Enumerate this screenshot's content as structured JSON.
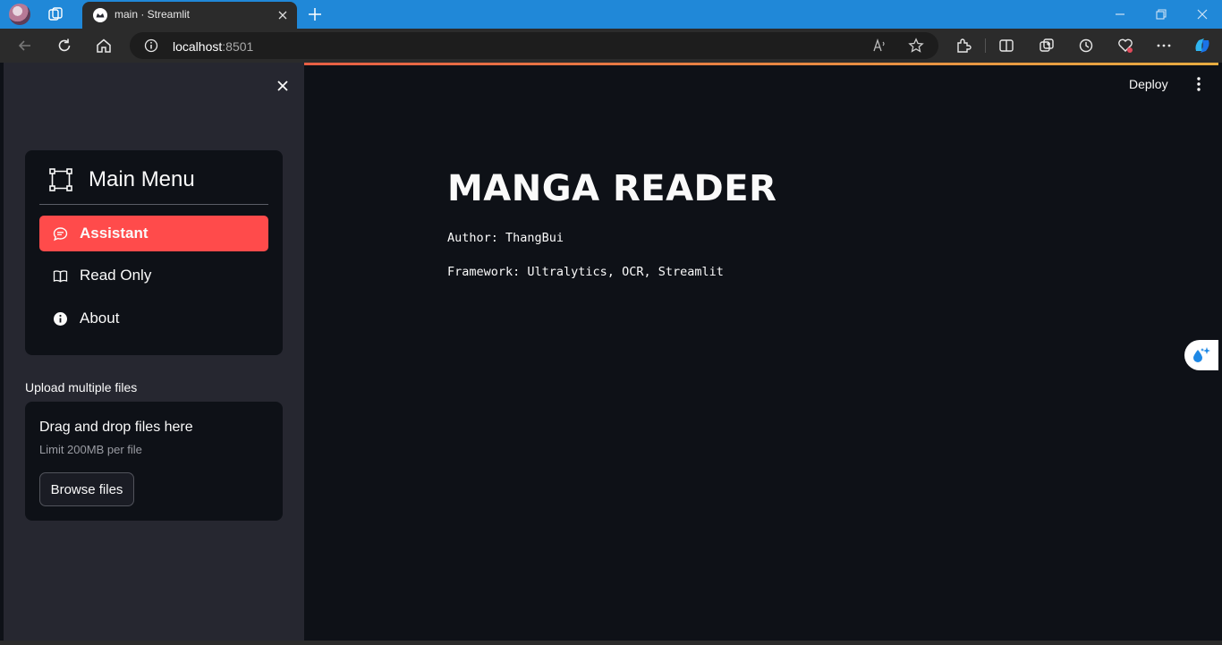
{
  "browser": {
    "tab_title": "main · Streamlit",
    "url_host": "localhost",
    "url_port": ":8501"
  },
  "header": {
    "deploy_label": "Deploy"
  },
  "sidebar": {
    "menu_title": "Main Menu",
    "items": [
      {
        "label": "Assistant",
        "icon": "chat-icon",
        "active": true
      },
      {
        "label": "Read Only",
        "icon": "book-icon",
        "active": false
      },
      {
        "label": "About",
        "icon": "info-icon",
        "active": false
      }
    ],
    "upload_label": "Upload multiple files",
    "dropzone_title": "Drag and drop files here",
    "dropzone_limit": "Limit 200MB per file",
    "browse_label": "Browse files"
  },
  "main": {
    "title": "MANGA READER",
    "author": "Author: ThangBui",
    "framework": "Framework: Ultralytics, OCR, Streamlit"
  },
  "colors": {
    "accent": "#ff4b4b",
    "background": "#0e1117",
    "sidebar": "#262730",
    "browser_frame": "#2088d8"
  }
}
